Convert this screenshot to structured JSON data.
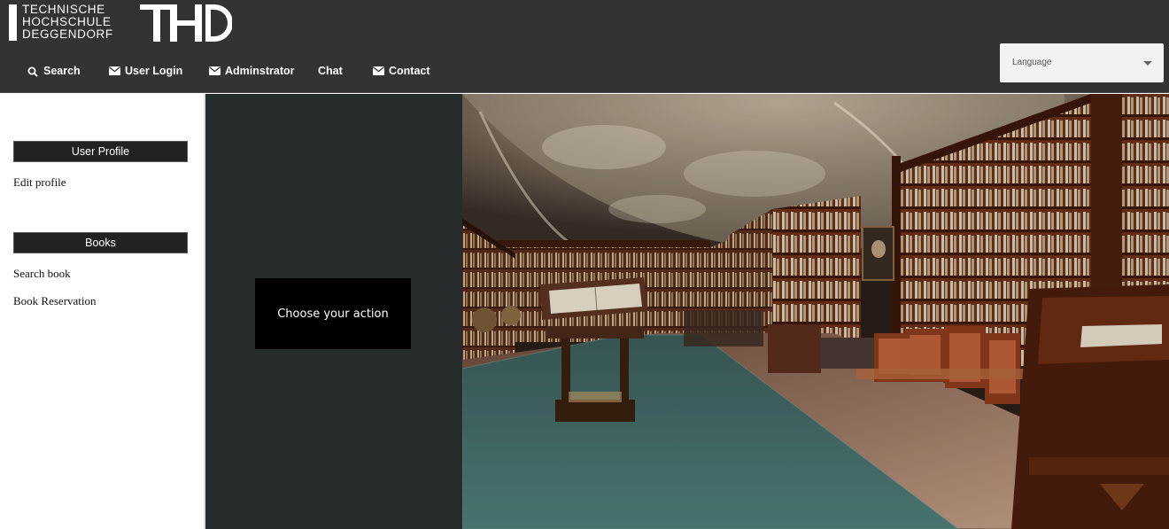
{
  "header": {
    "logo": {
      "lines": [
        "TECHNISCHE",
        "HOCHSCHULE",
        "DEGGENDORF"
      ],
      "mark": "THD"
    },
    "nav": [
      {
        "label": "Search",
        "icon": "search-icon"
      },
      {
        "label": "User Login",
        "icon": "envelope-icon"
      },
      {
        "label": "Adminstrator",
        "icon": "envelope-icon"
      },
      {
        "label": "Chat",
        "icon": ""
      },
      {
        "label": "Contact",
        "icon": "envelope-icon"
      }
    ],
    "language_select": {
      "value": "Language"
    }
  },
  "sidebar": {
    "sections": [
      {
        "title": "User Profile",
        "links": [
          "Edit profile"
        ]
      },
      {
        "title": "Books",
        "links": [
          "Search book",
          "Book Reservation"
        ]
      }
    ]
  },
  "main": {
    "action_prompt": "Choose your action"
  },
  "colors": {
    "header_bg": "#333333",
    "middle_panel_bg": "#262b2c",
    "section_header_bg": "#222222",
    "action_box_bg": "#000000"
  }
}
